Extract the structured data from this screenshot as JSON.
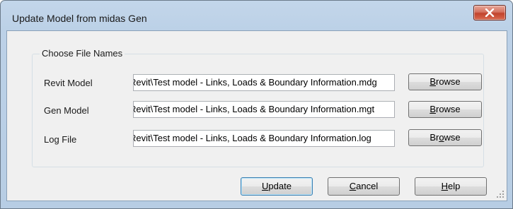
{
  "window": {
    "title": "Update Model from midas Gen",
    "close_icon": "close-icon"
  },
  "group": {
    "label": "Choose File Names"
  },
  "fields": [
    {
      "label": "Revit Model",
      "value": "Revit\\Test model - Links, Loads & Boundary Information.mdg",
      "browse": {
        "pre": "",
        "key": "B",
        "post": "rowse"
      }
    },
    {
      "label": "Gen Model",
      "value": "Revit\\Test model - Links, Loads & Boundary Information.mgt",
      "browse": {
        "pre": "",
        "key": "B",
        "post": "rowse"
      }
    },
    {
      "label": "Log File",
      "value": "Revit\\Test model - Links, Loads & Boundary Information.log",
      "browse": {
        "pre": "Br",
        "key": "o",
        "post": "wse"
      }
    }
  ],
  "buttons": {
    "update": {
      "key": "U",
      "rest": "pdate"
    },
    "cancel": {
      "key": "C",
      "rest": "ancel"
    },
    "help": {
      "key": "H",
      "rest": "elp"
    }
  },
  "colors": {
    "titlebar": "#c3d6ea",
    "close": "#c1432d",
    "client": "#f0f0f0"
  }
}
